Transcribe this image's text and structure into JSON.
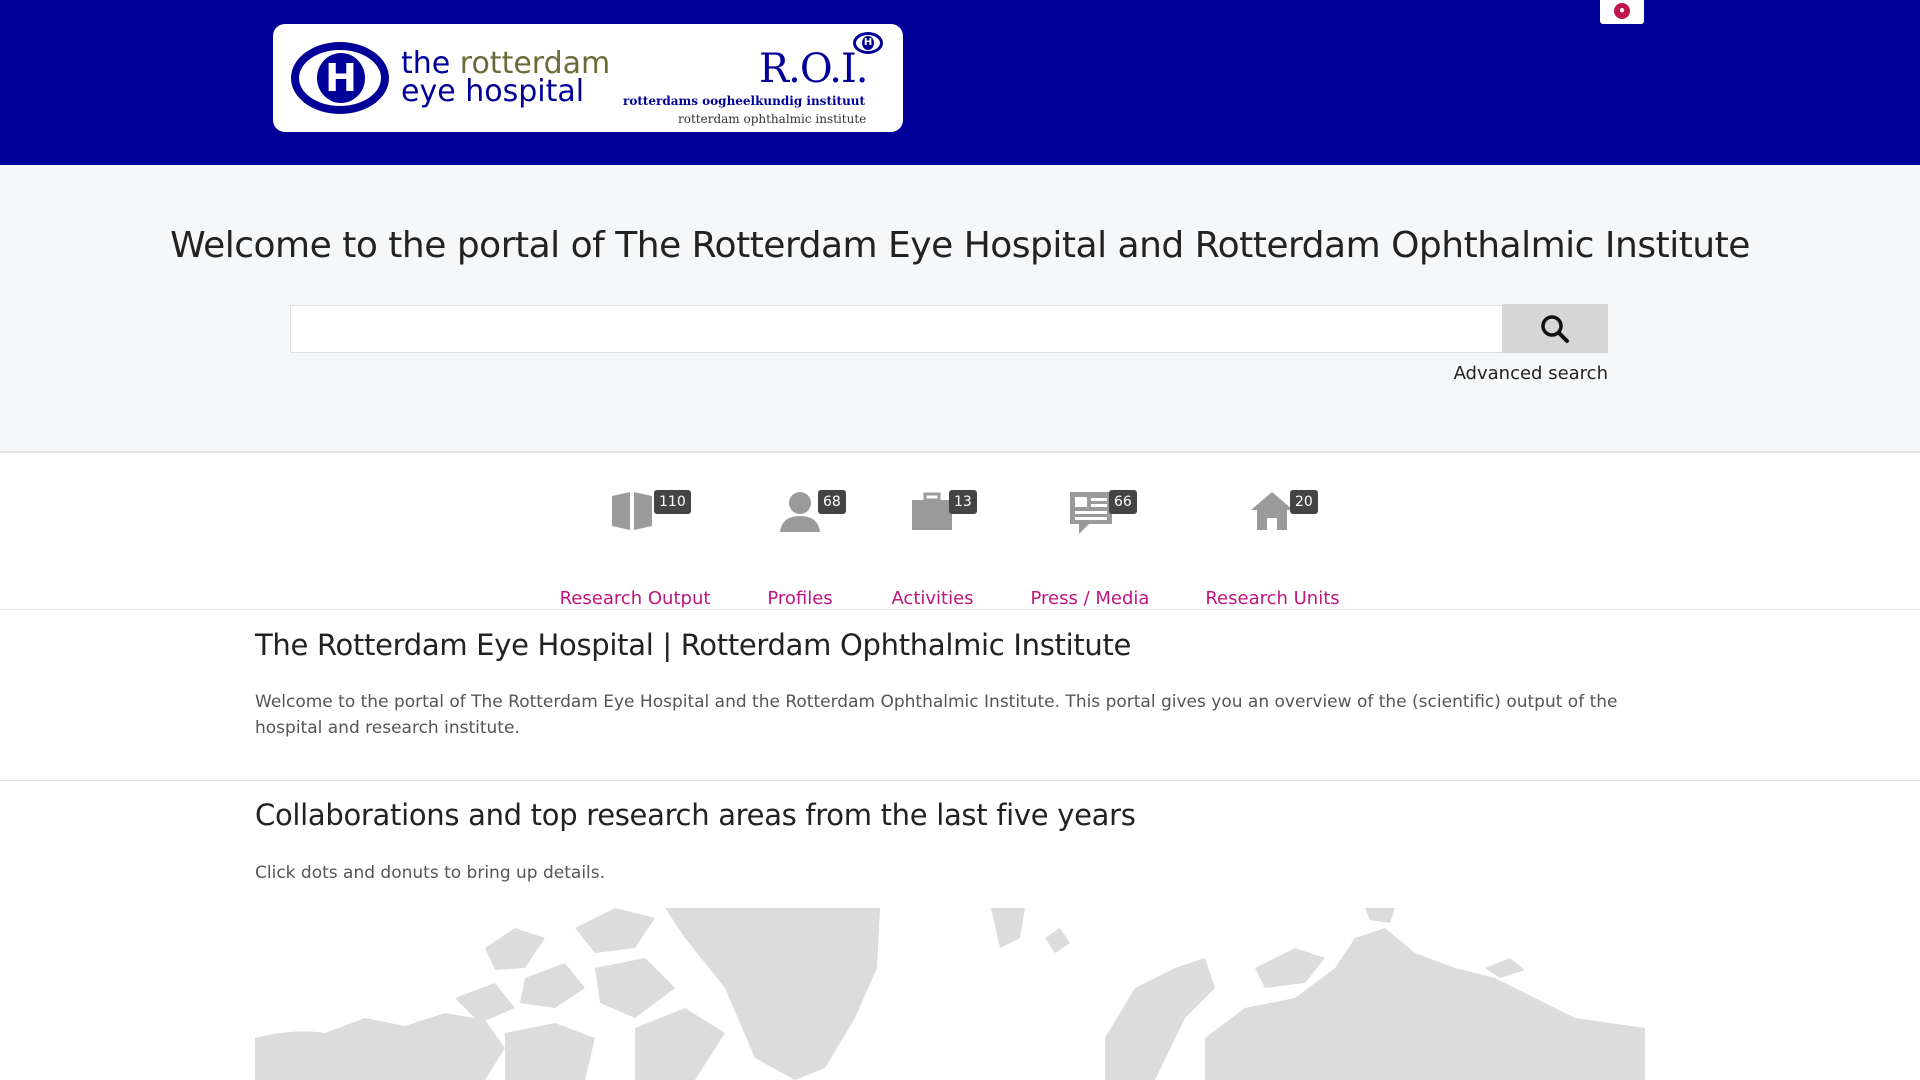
{
  "header": {
    "logo_line1a": "the ",
    "logo_line1b": "rotterdam",
    "logo_line2": "eye hospital",
    "roi_title": "R.O.I.",
    "roi_sub1": "rotterdams oogheelkundig instituut",
    "roi_sub2": "rotterdam ophthalmic institute",
    "logo_mark": "H"
  },
  "search": {
    "title": "Welcome to the portal of The Rotterdam Eye Hospital and Rotterdam Ophthalmic Institute",
    "value": "",
    "advanced_label": "Advanced search"
  },
  "nav": [
    {
      "label": "Research Output",
      "count": "110",
      "icon": "book-icon"
    },
    {
      "label": "Profiles",
      "count": "68",
      "icon": "person-icon"
    },
    {
      "label": "Activities",
      "count": "13",
      "icon": "briefcase-icon"
    },
    {
      "label": "Press / Media",
      "count": "66",
      "icon": "newspaper-icon"
    },
    {
      "label": "Research Units",
      "count": "20",
      "icon": "house-icon"
    }
  ],
  "intro": {
    "title": "The Rotterdam Eye Hospital | Rotterdam Ophthalmic Institute",
    "text": "Welcome to the portal of The Rotterdam Eye Hospital and the Rotterdam Ophthalmic Institute. This portal gives you an overview of the (scientific) output of the hospital and research institute."
  },
  "collab": {
    "title": "Collaborations and top research areas from the last five years",
    "hint": "Click dots and donuts to bring up details."
  }
}
